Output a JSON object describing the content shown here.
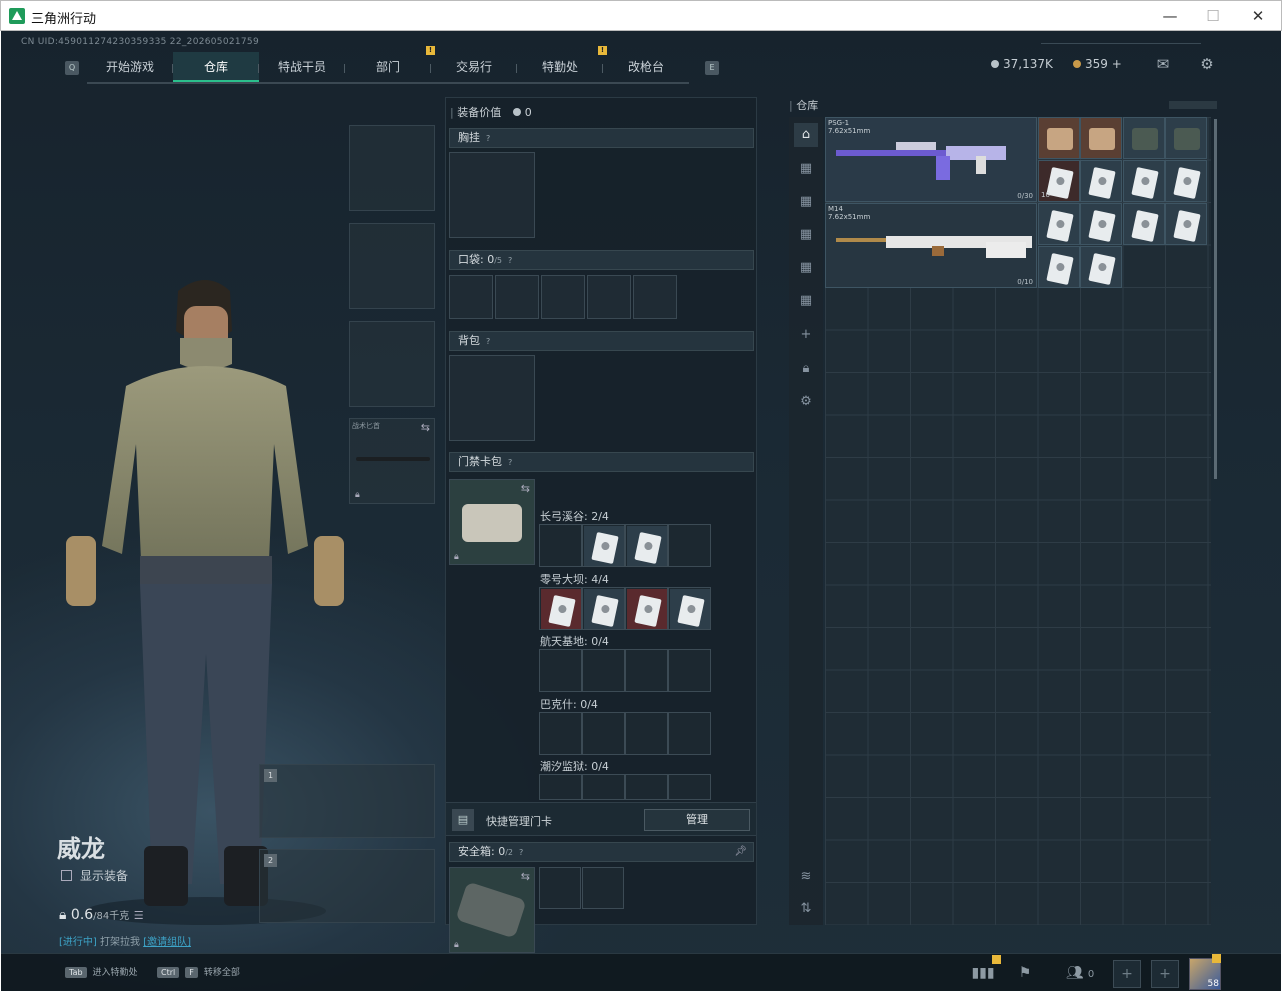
{
  "window": {
    "title": "三角洲行动",
    "minimize": "—",
    "maximize": "☐",
    "close": "✕"
  },
  "uid": "CN UID:459011274230359335 22_202605021759",
  "nav": {
    "left_key": "Q",
    "right_key": "E",
    "tabs": [
      {
        "label": "开始游戏",
        "active": false,
        "alert": false
      },
      {
        "label": "仓库",
        "active": true,
        "alert": false
      },
      {
        "label": "特战干员",
        "active": false,
        "alert": false
      },
      {
        "label": "部门",
        "active": false,
        "alert": true
      },
      {
        "label": "交易行",
        "active": false,
        "alert": false
      },
      {
        "label": "特勤处",
        "active": false,
        "alert": true
      },
      {
        "label": "改枪台",
        "active": false,
        "alert": false
      }
    ]
  },
  "currency": {
    "silver": "37,137K",
    "gold": "359",
    "plus": "+"
  },
  "character": {
    "name": "威龙",
    "show_equipment": "显示装备",
    "weight": "0.6",
    "weight_max": "/84千克",
    "invite_prefix": "[进行中]",
    "invite_middle": " 打架拉我 ",
    "invite_link": "[邀请组队]"
  },
  "slots": {
    "knife_label": "战术匕首",
    "weapon1": "1",
    "weapon2": "2"
  },
  "center": {
    "equip_value_label": "装备价值",
    "equip_value": "0",
    "chest": "胸挂",
    "pocket": "口袋: 0",
    "pocket_max": "/5",
    "backpack": "背包",
    "keycard": "门禁卡包",
    "q": "?",
    "groups": [
      {
        "label": "长弓溪谷: 2/4"
      },
      {
        "label": "零号大坝: 4/4"
      },
      {
        "label": "航天基地: 0/4"
      },
      {
        "label": "巴克什: 0/4"
      },
      {
        "label": "潮汐监狱: 0/4"
      }
    ],
    "quick_manage": "快捷管理门卡",
    "manage_btn": "管理",
    "safe_box": "安全箱: 0",
    "safe_max": "/2"
  },
  "warehouse": {
    "title": "仓库",
    "items": [
      {
        "name": "PSG-1\n7.62x51mm",
        "count": "0/30"
      },
      {
        "name": "M14\n7.62x51mm",
        "count": "0/10"
      },
      {
        "name": "",
        "count": "10"
      }
    ]
  },
  "bottom": {
    "tab_key": "Tab",
    "tab_label": "进入特勤处",
    "ctrl_key": "Ctrl",
    "f_key": "F",
    "ctrl_label": "转移全部",
    "friends": "0",
    "level": "58"
  },
  "colors": {
    "accent": "#2bbf8c",
    "alert": "#e8b83a",
    "panel": "#17222a"
  }
}
